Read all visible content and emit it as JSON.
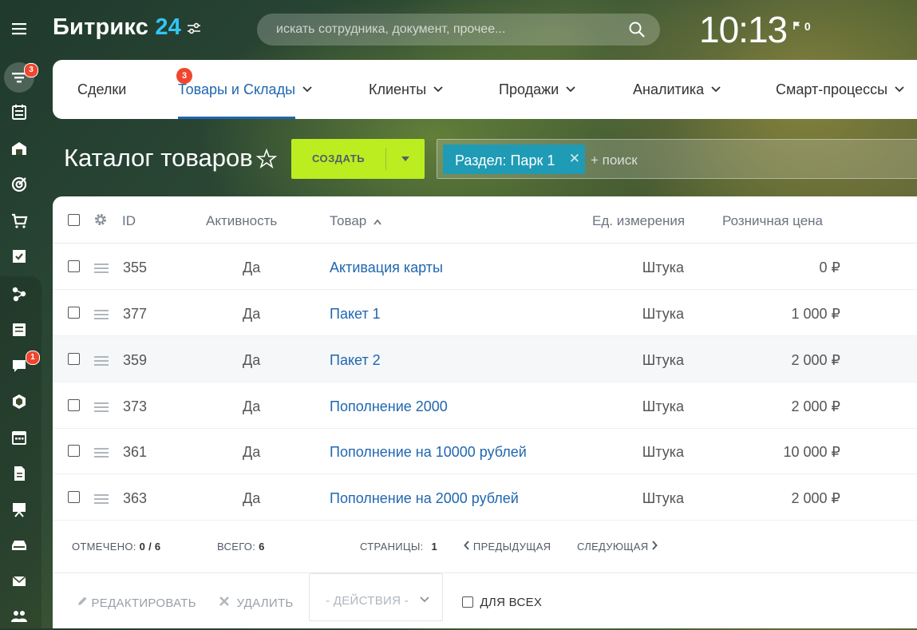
{
  "header": {
    "logo_text": "Битрикс",
    "logo_num": "24",
    "search_placeholder": "искать сотрудника, документ, прочее...",
    "clock": "10:13",
    "flag_count": "0"
  },
  "sidebar": {
    "items": [
      {
        "name": "menu",
        "icon": "hamburger-icon"
      },
      {
        "name": "crm-filter",
        "icon": "funnel-icon",
        "badge": "3"
      },
      {
        "name": "tasks",
        "icon": "checklist-icon"
      },
      {
        "name": "store",
        "icon": "warehouse-icon"
      },
      {
        "name": "goals",
        "icon": "target-icon"
      },
      {
        "name": "shop",
        "icon": "cart-icon"
      },
      {
        "name": "task-check",
        "icon": "checkbox-icon"
      },
      {
        "name": "sites",
        "icon": "network-icon"
      },
      {
        "name": "feed",
        "icon": "newspaper-icon"
      },
      {
        "name": "chat",
        "icon": "chat-icon",
        "badge": "1"
      },
      {
        "name": "bi",
        "icon": "hexagon-icon"
      },
      {
        "name": "calendar",
        "icon": "calendar-icon"
      },
      {
        "name": "docs",
        "icon": "document-icon"
      },
      {
        "name": "presentation",
        "icon": "presentation-icon"
      },
      {
        "name": "drive",
        "icon": "drive-icon"
      },
      {
        "name": "mail",
        "icon": "mail-icon"
      },
      {
        "name": "team",
        "icon": "users-icon"
      }
    ]
  },
  "nav": {
    "tabs": [
      {
        "label": "Сделки",
        "badge": "3"
      },
      {
        "label": "Товары и Склады"
      },
      {
        "label": "Клиенты"
      },
      {
        "label": "Продажи"
      },
      {
        "label": "Аналитика"
      },
      {
        "label": "Смарт-процессы"
      }
    ]
  },
  "page": {
    "title": "Каталог товаров",
    "create_label": "СОЗДАТЬ",
    "filter_chip": "Раздел: Парк 1",
    "filter_search": "+ поиск"
  },
  "grid": {
    "columns": [
      "ID",
      "Активность",
      "Товар",
      "Ед. измерения",
      "Розничная цена"
    ],
    "rows": [
      {
        "id": "355",
        "active": "Да",
        "name": "Активация карты",
        "unit": "Штука",
        "price": "0 ₽"
      },
      {
        "id": "377",
        "active": "Да",
        "name": "Пакет 1",
        "unit": "Штука",
        "price": "1 000 ₽"
      },
      {
        "id": "359",
        "active": "Да",
        "name": "Пакет 2",
        "unit": "Штука",
        "price": "2 000 ₽"
      },
      {
        "id": "373",
        "active": "Да",
        "name": "Пополнение 2000",
        "unit": "Штука",
        "price": "2 000 ₽"
      },
      {
        "id": "361",
        "active": "Да",
        "name": "Пополнение на 10000 рублей",
        "unit": "Штука",
        "price": "10 000 ₽"
      },
      {
        "id": "363",
        "active": "Да",
        "name": "Пополнение на 2000 рублей",
        "unit": "Штука",
        "price": "2 000 ₽"
      }
    ],
    "footer": {
      "selected_label": "ОТМЕЧЕНО:",
      "selected_value": "0 / 6",
      "total_label": "ВСЕГО:",
      "total_value": "6",
      "pages_label": "СТРАНИЦЫ:",
      "pages_value": "1",
      "prev": "ПРЕДЫДУЩАЯ",
      "next": "СЛЕДУЮЩАЯ"
    },
    "actions": {
      "edit": "РЕДАКТИРОВАТЬ",
      "delete": "УДАЛИТЬ",
      "select": "- ДЕЙСТВИЯ -",
      "for_all": "ДЛЯ ВСЕХ"
    }
  },
  "colors": {
    "accent": "#2067b0",
    "create_button": "#bbed21",
    "filter_chip": "#1f9bb5",
    "badge": "#f0462f",
    "logo_number": "#2fc6f6"
  }
}
